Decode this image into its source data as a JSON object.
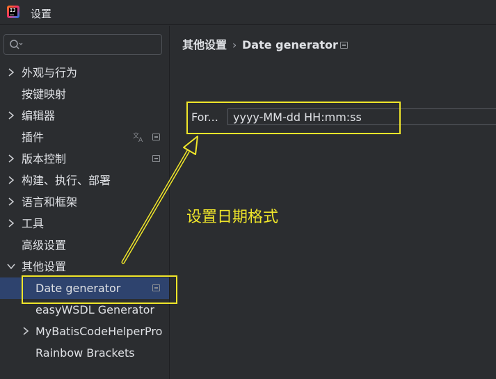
{
  "window": {
    "title": "设置",
    "app_icon": "intellij-idea-icon",
    "app_icon_text": "IJ"
  },
  "search": {
    "placeholder": "",
    "value": "",
    "icon": "search-icon"
  },
  "tree": {
    "items": [
      {
        "label": "外观与行为",
        "expandable": true,
        "expanded": false,
        "level": 0
      },
      {
        "label": "按键映射",
        "expandable": false,
        "level": 0
      },
      {
        "label": "编辑器",
        "expandable": true,
        "expanded": false,
        "level": 0
      },
      {
        "label": "插件",
        "expandable": false,
        "level": 0,
        "icons": [
          "translate-icon",
          "project-module-icon"
        ]
      },
      {
        "label": "版本控制",
        "expandable": true,
        "expanded": false,
        "level": 0,
        "icons": [
          "project-module-icon"
        ]
      },
      {
        "label": "构建、执行、部署",
        "expandable": true,
        "expanded": false,
        "level": 0
      },
      {
        "label": "语言和框架",
        "expandable": true,
        "expanded": false,
        "level": 0
      },
      {
        "label": "工具",
        "expandable": true,
        "expanded": false,
        "level": 0
      },
      {
        "label": "高级设置",
        "expandable": false,
        "level": 0
      },
      {
        "label": "其他设置",
        "expandable": true,
        "expanded": true,
        "level": 0
      },
      {
        "label": "Date generator",
        "expandable": false,
        "level": 1,
        "selected": true,
        "icons": [
          "project-module-icon"
        ]
      },
      {
        "label": "easyWSDL Generator",
        "expandable": false,
        "level": 1
      },
      {
        "label": "MyBatisCodeHelperPro",
        "expandable": true,
        "expanded": false,
        "level": 1
      },
      {
        "label": "Rainbow Brackets",
        "expandable": false,
        "level": 1
      }
    ]
  },
  "breadcrumb": {
    "parent": "其他设置",
    "separator": "›",
    "current": "Date generator",
    "icon": "project-module-icon"
  },
  "form": {
    "format_label": "For...",
    "format_value": "yyyy-MM-dd HH:mm:ss"
  },
  "annotation": {
    "text": "设置日期格式",
    "color": "#f0e62a"
  },
  "colors": {
    "background": "#2b2d30",
    "selection": "#2e436e",
    "text": "#dfe1e5",
    "highlight": "#f0e62a"
  }
}
